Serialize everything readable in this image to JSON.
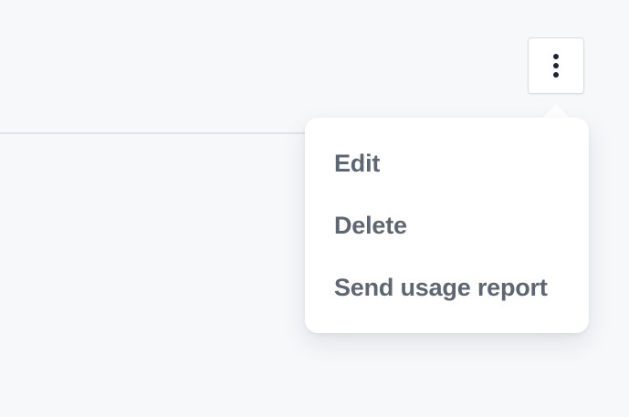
{
  "toolbar": {
    "more_button_icon": "vertical-ellipsis-icon"
  },
  "menu": {
    "items": [
      {
        "label": "Edit"
      },
      {
        "label": "Delete"
      },
      {
        "label": "Send usage report"
      }
    ]
  },
  "colors": {
    "background": "#f7f8fa",
    "menu_text": "#5e6671",
    "icon": "#1f2430"
  }
}
